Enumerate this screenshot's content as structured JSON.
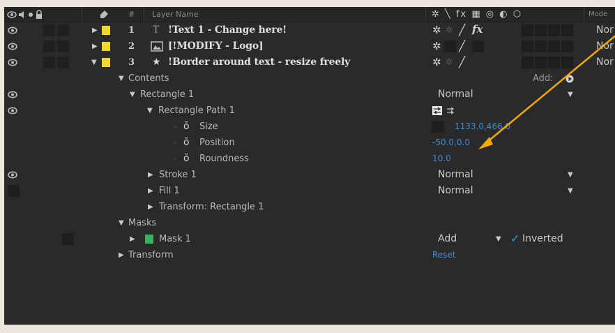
{
  "header": {
    "hash": "#",
    "layer_name": "Layer Name",
    "mode_col": "Mode",
    "switch_glyphs": "✲ ╲ fx ▦ ◎ ◐ ⬡"
  },
  "layers": [
    {
      "num": "1",
      "name": "!Text 1 - Change here!",
      "mode": "Nor",
      "type": "text"
    },
    {
      "num": "2",
      "name": "[!MODIFY - Logo]",
      "mode": "Nor",
      "type": "image"
    },
    {
      "num": "3",
      "name": "!Border around text - resize freely",
      "mode": "Nor",
      "type": "shape"
    }
  ],
  "tree": {
    "contents": "Contents",
    "add_label": "Add:",
    "rectangle": "Rectangle 1",
    "rectangle_mode": "Normal",
    "rect_path": "Rectangle Path 1",
    "size_label": "Size",
    "size_value": "1133.0,466.0",
    "position_label": "Position",
    "position_value": "-50.0,0.0",
    "roundness_label": "Roundness",
    "roundness_value": "10.0",
    "stroke": "Stroke 1",
    "stroke_mode": "Normal",
    "fill": "Fill 1",
    "fill_mode": "Normal",
    "transform_rect": "Transform: Rectangle 1",
    "masks": "Masks",
    "mask": "Mask 1",
    "mask_mode": "Add",
    "inverted": "Inverted",
    "transform": "Transform",
    "reset": "Reset"
  },
  "colors": {
    "label_yellow": "#f2d930",
    "mask_green": "#3cb05a",
    "value_blue": "#3e8ed0",
    "arrow": "#f2a900",
    "checkbox_blue": "#2a9be0"
  },
  "icons": {
    "eye": "eye-icon",
    "stopwatch": "stopwatch-icon",
    "star": "shape-layer-icon",
    "text": "text-layer-icon",
    "image": "image-layer-icon"
  }
}
